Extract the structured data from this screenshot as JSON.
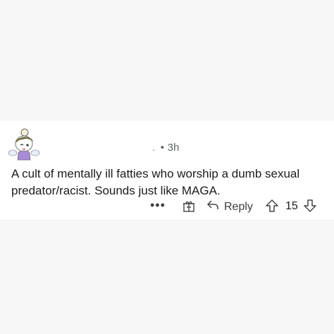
{
  "comment": {
    "meta_separator": ". ",
    "timestamp": "• 3h",
    "body": "A cult of mentally ill fatties who worship a dumb sexual predator/racist. Sounds just like MAGA.",
    "actions": {
      "more_label": "•••",
      "reply_label": "Reply",
      "score": "15"
    }
  },
  "icons": {
    "avatar": "avatar-icon",
    "award": "gift-icon",
    "reply": "reply-arrow-icon",
    "upvote": "upvote-arrow-icon",
    "downvote": "downvote-arrow-icon"
  }
}
